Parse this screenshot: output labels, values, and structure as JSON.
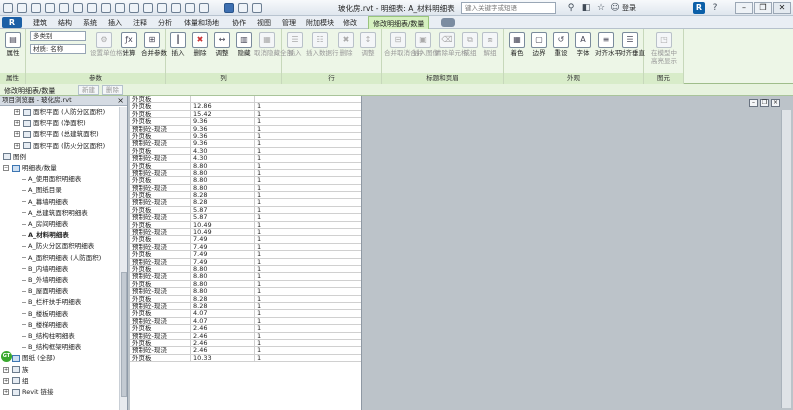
{
  "window": {
    "title": "玻化房.rvt - 明细表: A_材料明细表",
    "minimize": "–",
    "restore": "❐",
    "close": "✕"
  },
  "search": {
    "placeholder": "键入关键字或短语"
  },
  "user": {
    "login": "登录",
    "app_logo_text": "R"
  },
  "app_menu": {
    "label": "R"
  },
  "tabs": [
    "建筑",
    "结构",
    "系统",
    "插入",
    "注释",
    "分析",
    "体量和场地",
    "协作",
    "视图",
    "管理",
    "附加模块",
    "修改",
    "修改明细表/数量"
  ],
  "ribbon": {
    "props": {
      "label": "属性",
      "button": "属性"
    },
    "params": {
      "label": "参数",
      "category_select": "多类别",
      "material_select": "材质: 名称",
      "btn_format": "设置单位格式",
      "btn_calc": "计算",
      "btn_merge": "合并参数"
    },
    "columns": {
      "label": "列",
      "btn_insert": "插入",
      "btn_delete": "删除",
      "btn_resize": "调整",
      "btn_hide": "隐藏",
      "btn_unhide": "取消隐藏全部"
    },
    "rows": {
      "label": "行",
      "btn_insert": "插入",
      "btn_insert_data": "插入数据行",
      "btn_delete": "删除",
      "btn_resize": "调整"
    },
    "titles": {
      "label": "标题和页眉",
      "btn_merge": "合并取消合并",
      "btn_image": "插入图像",
      "btn_clear": "清除单元格",
      "btn_group": "成组",
      "btn_ungroup": "解组"
    },
    "appearance": {
      "label": "外观",
      "btn_shading": "着色",
      "btn_borders": "边界",
      "btn_reset": "重设",
      "btn_font": "字体",
      "btn_align_h": "对齐水平",
      "btn_align_v": "对齐垂直"
    },
    "element": {
      "label": "图元",
      "btn_highlight": "在模型中高亮显示"
    }
  },
  "context_bar": {
    "label": "修改明细表/数量",
    "btn_new": "新建",
    "btn_delete": "删除"
  },
  "browser": {
    "title": "项目浏览器 - 玻化房.rvt",
    "close": "×",
    "nodes": [
      {
        "text": "面积平面 (人防分区面积)",
        "indent": 1,
        "exp": "+",
        "bold": false,
        "icon": "plan"
      },
      {
        "text": "面积平面 (净面积)",
        "indent": 1,
        "exp": "+",
        "bold": false,
        "icon": "plan"
      },
      {
        "text": "面积平面 (总建筑面积)",
        "indent": 1,
        "exp": "+",
        "bold": false,
        "icon": "plan"
      },
      {
        "text": "面积平面 (防火分区面积)",
        "indent": 1,
        "exp": "+",
        "bold": false,
        "icon": "plan"
      },
      {
        "text": "图例",
        "indent": 0,
        "exp": "",
        "bold": false,
        "icon": "plan"
      },
      {
        "text": "明细表/数量",
        "indent": 0,
        "exp": "−",
        "bold": false,
        "icon": "sheet"
      },
      {
        "text": "A_使用面积明细表",
        "indent": 2,
        "exp": "",
        "bold": false,
        "icon": ""
      },
      {
        "text": "A_图纸目录",
        "indent": 2,
        "exp": "",
        "bold": false,
        "icon": ""
      },
      {
        "text": "A_幕墙明细表",
        "indent": 2,
        "exp": "",
        "bold": false,
        "icon": ""
      },
      {
        "text": "A_总建筑面积明细表",
        "indent": 2,
        "exp": "",
        "bold": false,
        "icon": ""
      },
      {
        "text": "A_房间明细表",
        "indent": 2,
        "exp": "",
        "bold": false,
        "icon": ""
      },
      {
        "text": "A_材料明细表",
        "indent": 2,
        "exp": "",
        "bold": true,
        "icon": ""
      },
      {
        "text": "A_防火分区面积明细表",
        "indent": 2,
        "exp": "",
        "bold": false,
        "icon": ""
      },
      {
        "text": "A_面积明细表 (人防面积)",
        "indent": 2,
        "exp": "",
        "bold": false,
        "icon": ""
      },
      {
        "text": "B_内墙明细表",
        "indent": 2,
        "exp": "",
        "bold": false,
        "icon": ""
      },
      {
        "text": "B_外墙明细表",
        "indent": 2,
        "exp": "",
        "bold": false,
        "icon": ""
      },
      {
        "text": "B_屋面明细表",
        "indent": 2,
        "exp": "",
        "bold": false,
        "icon": ""
      },
      {
        "text": "B_栏杆扶手明细表",
        "indent": 2,
        "exp": "",
        "bold": false,
        "icon": ""
      },
      {
        "text": "B_楼板明细表",
        "indent": 2,
        "exp": "",
        "bold": false,
        "icon": ""
      },
      {
        "text": "B_楼梯明细表",
        "indent": 2,
        "exp": "",
        "bold": false,
        "icon": ""
      },
      {
        "text": "B_结构柱明细表",
        "indent": 2,
        "exp": "",
        "bold": false,
        "icon": ""
      },
      {
        "text": "B_结构框架明细表",
        "indent": 2,
        "exp": "",
        "bold": false,
        "icon": ""
      },
      {
        "text": "图纸 (全部)",
        "indent": 0,
        "exp": "+",
        "bold": false,
        "icon": "sheet"
      },
      {
        "text": "族",
        "indent": 0,
        "exp": "+",
        "bold": false,
        "icon": "plan"
      },
      {
        "text": "组",
        "indent": 0,
        "exp": "+",
        "bold": false,
        "icon": "plan"
      },
      {
        "text": "Revit 链接",
        "indent": 0,
        "exp": "+",
        "bold": false,
        "icon": "plan"
      }
    ]
  },
  "badge": {
    "text": "GT"
  },
  "schedule": {
    "rows": [
      [
        "外页板",
        "",
        ""
      ],
      [
        "外页板",
        "12.86",
        "1"
      ],
      [
        "外页板",
        "15.42",
        "1"
      ],
      [
        "外页板",
        "9.36",
        "1"
      ],
      [
        "预制砼-现浇",
        "9.36",
        "1"
      ],
      [
        "外页板",
        "9.36",
        "1"
      ],
      [
        "预制砼-现浇",
        "9.36",
        "1"
      ],
      [
        "外页板",
        "4.30",
        "1"
      ],
      [
        "预制砼-现浇",
        "4.30",
        "1"
      ],
      [
        "外页板",
        "8.80",
        "1"
      ],
      [
        "预制砼-现浇",
        "8.80",
        "1"
      ],
      [
        "外页板",
        "8.80",
        "1"
      ],
      [
        "预制砼-现浇",
        "8.80",
        "1"
      ],
      [
        "外页板",
        "8.28",
        "1"
      ],
      [
        "预制砼-现浇",
        "8.28",
        "1"
      ],
      [
        "外页板",
        "5.87",
        "1"
      ],
      [
        "预制砼-现浇",
        "5.87",
        "1"
      ],
      [
        "外页板",
        "10.49",
        "1"
      ],
      [
        "预制砼-现浇",
        "10.49",
        "1"
      ],
      [
        "外页板",
        "7.49",
        "1"
      ],
      [
        "预制砼-现浇",
        "7.49",
        "1"
      ],
      [
        "外页板",
        "7.49",
        "1"
      ],
      [
        "预制砼-现浇",
        "7.49",
        "1"
      ],
      [
        "外页板",
        "8.80",
        "1"
      ],
      [
        "预制砼-现浇",
        "8.80",
        "1"
      ],
      [
        "外页板",
        "8.80",
        "1"
      ],
      [
        "预制砼-现浇",
        "8.80",
        "1"
      ],
      [
        "外页板",
        "8.28",
        "1"
      ],
      [
        "预制砼-现浇",
        "8.28",
        "1"
      ],
      [
        "外页板",
        "4.07",
        "1"
      ],
      [
        "预制砼-现浇",
        "4.07",
        "1"
      ],
      [
        "外页板",
        "2.46",
        "1"
      ],
      [
        "预制砼-现浇",
        "2.46",
        "1"
      ],
      [
        "外页板",
        "2.46",
        "1"
      ],
      [
        "预制砼-现浇",
        "2.46",
        "1"
      ],
      [
        "外页板",
        "10.33",
        "1"
      ]
    ]
  },
  "view_controls": [
    "–",
    "❐",
    "×"
  ]
}
